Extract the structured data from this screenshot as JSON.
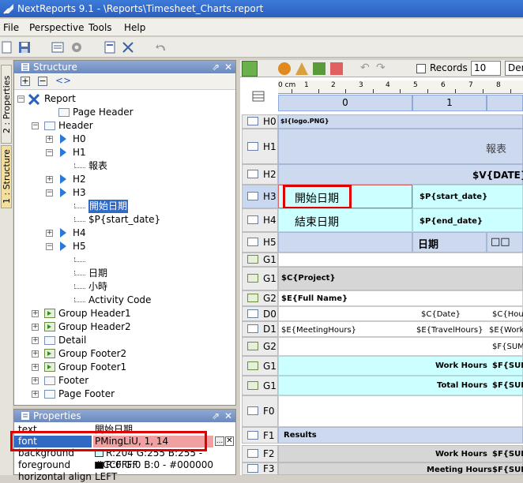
{
  "window": {
    "title": "NextReports 9.1 - \\Reports\\Timesheet_Charts.report"
  },
  "menu": [
    {
      "label": "File"
    },
    {
      "label": "Perspective"
    },
    {
      "label": "Tools"
    },
    {
      "label": "Help"
    }
  ],
  "side_tabs": {
    "properties": "2 : Properties",
    "structure": "1 : Structure"
  },
  "structure_panel": {
    "title": "Structure",
    "tree": [
      {
        "label": "Report"
      },
      {
        "label": "Page Header"
      },
      {
        "label": "Header"
      },
      {
        "label": "H0"
      },
      {
        "label": "H1"
      },
      {
        "label": "報表"
      },
      {
        "label": "H2"
      },
      {
        "label": "H3"
      },
      {
        "label": "開始日期"
      },
      {
        "label": "$P{start_date}"
      },
      {
        "label": "H4"
      },
      {
        "label": "H5"
      },
      {
        "label": "日期"
      },
      {
        "label": "小時"
      },
      {
        "label": "Activity Code"
      },
      {
        "label": "Group Header1"
      },
      {
        "label": "Group Header2"
      },
      {
        "label": "Detail"
      },
      {
        "label": "Group Footer2"
      },
      {
        "label": "Group Footer1"
      },
      {
        "label": "Footer"
      },
      {
        "label": "Page Footer"
      }
    ]
  },
  "properties_panel": {
    "title": "Properties",
    "rows": [
      {
        "key": "text",
        "value": "開始日期"
      },
      {
        "key": "font",
        "value": "PMingLiU, 1, 14"
      },
      {
        "key": "background",
        "value": "R:204 G:255 B:255 - #CCFFFF",
        "color": "#ccffff"
      },
      {
        "key": "foreground",
        "value": "R:0 G:0 B:0 - #000000",
        "color": "#000000"
      },
      {
        "key": "horizontal align",
        "value": "LEFT"
      }
    ],
    "font_btn": "..."
  },
  "designer": {
    "records_label": "Records",
    "records_value": "10",
    "dropdown_value": "Den",
    "ruler": {
      "unit": "cm",
      "labels": [
        "0",
        "1",
        "2",
        "3",
        "4",
        "5",
        "6",
        "7",
        "8"
      ]
    },
    "columns": [
      {
        "label": "0"
      },
      {
        "label": "1"
      }
    ],
    "rows": [
      {
        "id": "H0",
        "cells": [
          {
            "text": "$I{logo.PNG}"
          }
        ]
      },
      {
        "id": "H1",
        "cells": [
          {
            "text": "報表"
          }
        ]
      },
      {
        "id": "H2",
        "cells": [
          {
            "text": "$V{DATE}"
          }
        ]
      },
      {
        "id": "H3",
        "cells": [
          {
            "text": "開始日期"
          },
          {
            "text": "$P{start_date}"
          }
        ]
      },
      {
        "id": "H4",
        "cells": [
          {
            "text": "結束日期"
          },
          {
            "text": "$P{end_date}"
          }
        ]
      },
      {
        "id": "H5",
        "cells": [
          {
            "text": "日期"
          },
          {
            "text": "□□"
          }
        ]
      },
      {
        "id": "G1",
        "cells": []
      },
      {
        "id": "G1",
        "cells": [
          {
            "text": "$C{Project}"
          }
        ]
      },
      {
        "id": "G2",
        "cells": [
          {
            "text": "$E{Full Name}"
          }
        ]
      },
      {
        "id": "D0",
        "cells": [
          {
            "text": "$C{Date}"
          },
          {
            "text": "$C{Hour"
          }
        ]
      },
      {
        "id": "D1",
        "cells": [
          {
            "text": "$E{MeetingHours}"
          },
          {
            "text": "$E{TravelHours}"
          },
          {
            "text": "$E{WorkH"
          }
        ]
      },
      {
        "id": "G2",
        "cells": [
          {
            "text": "$F{SUM("
          }
        ]
      },
      {
        "id": "G1",
        "cells": [
          {
            "text": "Work Hours"
          },
          {
            "text": "$F{SUM"
          }
        ]
      },
      {
        "id": "G1",
        "cells": [
          {
            "text": "Total Hours"
          },
          {
            "text": "$F{SUM"
          }
        ]
      },
      {
        "id": "F0",
        "cells": []
      },
      {
        "id": "F1",
        "cells": [
          {
            "text": "Results"
          }
        ]
      },
      {
        "id": "F2",
        "cells": [
          {
            "text": "Work Hours"
          },
          {
            "text": "$F{SUM"
          }
        ]
      },
      {
        "id": "F3",
        "cells": [
          {
            "text": "Meeting Hours"
          },
          {
            "text": "$F{SUM"
          }
        ]
      }
    ]
  }
}
